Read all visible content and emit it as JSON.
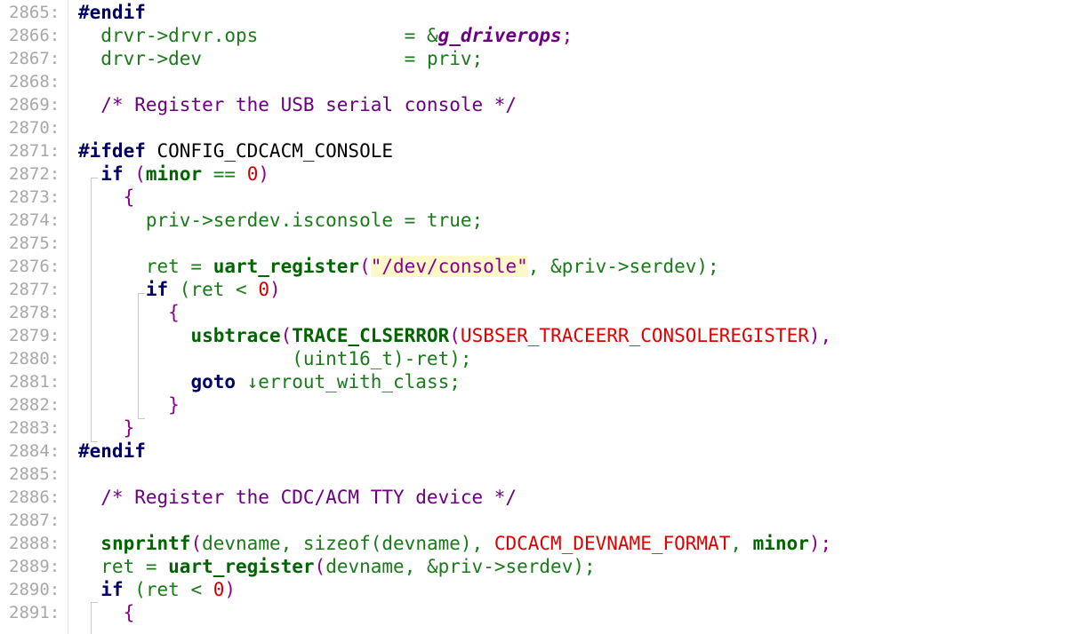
{
  "editor": {
    "lines": [
      {
        "n": "2865:",
        "tokens": [
          {
            "t": "#endif",
            "c": "pp"
          }
        ]
      },
      {
        "n": "2866:",
        "tokens": [
          {
            "t": "  drvr->drvr.ops             ",
            "c": "var"
          },
          {
            "t": "= &",
            "c": "op"
          },
          {
            "t": "g_driverops",
            "c": "bi"
          },
          {
            "t": ";",
            "c": "paren"
          }
        ]
      },
      {
        "n": "2867:",
        "tokens": [
          {
            "t": "  drvr->dev                  ",
            "c": "var"
          },
          {
            "t": "= priv;",
            "c": "op"
          }
        ]
      },
      {
        "n": "2868:",
        "tokens": []
      },
      {
        "n": "2869:",
        "tokens": [
          {
            "t": "  /* Register the USB serial console */",
            "c": "cm"
          }
        ]
      },
      {
        "n": "2870:",
        "tokens": []
      },
      {
        "n": "2871:",
        "tokens": [
          {
            "t": "#ifdef",
            "c": "pp"
          },
          {
            "t": " CONFIG_CDCACM_CONSOLE",
            "c": "plain"
          }
        ]
      },
      {
        "n": "2872:",
        "tokens": [
          {
            "t": "  ",
            "c": "plain"
          },
          {
            "t": "if",
            "c": "kw"
          },
          {
            "t": " (",
            "c": "paren"
          },
          {
            "t": "minor",
            "c": "fn"
          },
          {
            "t": " == ",
            "c": "op"
          },
          {
            "t": "0",
            "c": "num"
          },
          {
            "t": ")",
            "c": "paren"
          }
        ]
      },
      {
        "n": "2873:",
        "tokens": [
          {
            "t": "    {",
            "c": "brace"
          }
        ]
      },
      {
        "n": "2874:",
        "tokens": [
          {
            "t": "      priv->serdev.isconsole = true;",
            "c": "var"
          }
        ]
      },
      {
        "n": "2875:",
        "tokens": []
      },
      {
        "n": "2876:",
        "tokens": [
          {
            "t": "      ret = ",
            "c": "var"
          },
          {
            "t": "uart_register",
            "c": "fn"
          },
          {
            "t": "(",
            "c": "paren"
          },
          {
            "t": "\"/dev/console\"",
            "c": "strhl"
          },
          {
            "t": ", &priv->serdev);",
            "c": "var"
          }
        ]
      },
      {
        "n": "2877:",
        "tokens": [
          {
            "t": "      ",
            "c": "plain"
          },
          {
            "t": "if",
            "c": "kw"
          },
          {
            "t": " (ret < ",
            "c": "var"
          },
          {
            "t": "0",
            "c": "num"
          },
          {
            "t": ")",
            "c": "paren"
          }
        ]
      },
      {
        "n": "2878:",
        "tokens": [
          {
            "t": "        {",
            "c": "brace"
          }
        ]
      },
      {
        "n": "2879:",
        "tokens": [
          {
            "t": "          ",
            "c": "plain"
          },
          {
            "t": "usbtrace",
            "c": "fn"
          },
          {
            "t": "(",
            "c": "paren"
          },
          {
            "t": "TRACE_CLSERROR",
            "c": "fn"
          },
          {
            "t": "(",
            "c": "paren"
          },
          {
            "t": "USBSER_TRACEERR_CONSOLEREGISTER",
            "c": "macro"
          },
          {
            "t": "),",
            "c": "paren"
          }
        ]
      },
      {
        "n": "2880:",
        "tokens": [
          {
            "t": "                   (uint16_t)-ret);",
            "c": "var"
          }
        ]
      },
      {
        "n": "2881:",
        "tokens": [
          {
            "t": "          ",
            "c": "plain"
          },
          {
            "t": "goto",
            "c": "kw"
          },
          {
            "t": " ↓errout_with_class;",
            "c": "gotolbl"
          }
        ]
      },
      {
        "n": "2882:",
        "tokens": [
          {
            "t": "        }",
            "c": "brace"
          }
        ]
      },
      {
        "n": "2883:",
        "tokens": [
          {
            "t": "    }",
            "c": "brace"
          }
        ]
      },
      {
        "n": "2884:",
        "tokens": [
          {
            "t": "#endif",
            "c": "pp"
          }
        ]
      },
      {
        "n": "2885:",
        "tokens": []
      },
      {
        "n": "2886:",
        "tokens": [
          {
            "t": "  /* Register the CDC/ACM TTY device */",
            "c": "cm"
          }
        ]
      },
      {
        "n": "2887:",
        "tokens": []
      },
      {
        "n": "2888:",
        "tokens": [
          {
            "t": "  ",
            "c": "plain"
          },
          {
            "t": "snprintf",
            "c": "fn"
          },
          {
            "t": "(",
            "c": "paren"
          },
          {
            "t": "devname, sizeof(devname), ",
            "c": "var"
          },
          {
            "t": "CDCACM_DEVNAME_FORMAT",
            "c": "macro"
          },
          {
            "t": ", ",
            "c": "var"
          },
          {
            "t": "minor",
            "c": "fn"
          },
          {
            "t": ");",
            "c": "paren"
          }
        ]
      },
      {
        "n": "2889:",
        "tokens": [
          {
            "t": "  ret = ",
            "c": "var"
          },
          {
            "t": "uart_register",
            "c": "fn"
          },
          {
            "t": "(",
            "c": "paren"
          },
          {
            "t": "devname, &priv->serdev);",
            "c": "var"
          }
        ]
      },
      {
        "n": "2890:",
        "tokens": [
          {
            "t": "  ",
            "c": "plain"
          },
          {
            "t": "if",
            "c": "kw"
          },
          {
            "t": " (ret < ",
            "c": "var"
          },
          {
            "t": "0",
            "c": "num"
          },
          {
            "t": ")",
            "c": "paren"
          }
        ]
      },
      {
        "n": "2891:",
        "tokens": [
          {
            "t": "    {",
            "c": "brace"
          }
        ]
      }
    ]
  },
  "colors": {
    "background": "#ffffff",
    "line_number": "#a8a8a8",
    "keyword": "#000066",
    "function": "#006400",
    "identifier": "#1a7a1a",
    "macro": "#e00000",
    "number": "#d00000",
    "comment": "#6a0080",
    "string_highlight": "#fff8c8"
  }
}
